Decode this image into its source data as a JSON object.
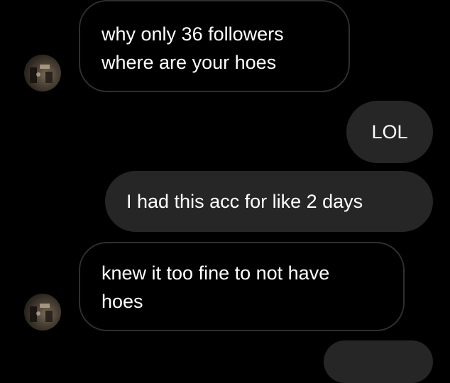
{
  "conversation": {
    "messages": [
      {
        "direction": "received",
        "text": "why only 36 followers\nwhere are your hoes"
      },
      {
        "direction": "sent",
        "text": "LOL"
      },
      {
        "direction": "sent",
        "text": "I had this acc for like 2 days"
      },
      {
        "direction": "received",
        "text": "knew it too fine to not have\nhoes"
      },
      {
        "direction": "sent",
        "text": ""
      }
    ],
    "avatar_icon": "contact-avatar-photo"
  },
  "colors": {
    "background": "#000000",
    "received_border": "#2f2f2f",
    "sent_bubble": "#262626",
    "text": "#ffffff"
  }
}
